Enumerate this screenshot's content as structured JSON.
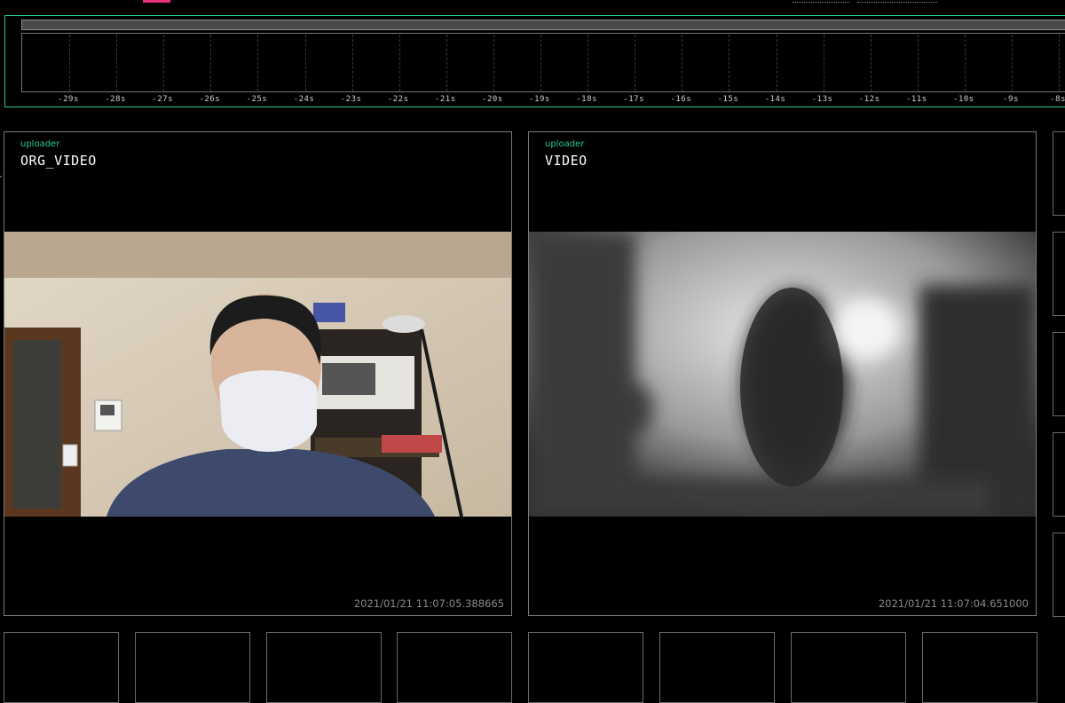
{
  "timeline": {
    "ticks": [
      "-29s",
      "-28s",
      "-27s",
      "-26s",
      "-25s",
      "-24s",
      "-23s",
      "-22s",
      "-21s",
      "-20s",
      "-19s",
      "-18s",
      "-17s",
      "-16s",
      "-15s",
      "-14s",
      "-13s",
      "-12s",
      "-11s",
      "-10s",
      "-9s",
      "-8s"
    ]
  },
  "cards": [
    {
      "subtitle": "uploader",
      "title": "ORG_VIDEO",
      "timestamp": "2021/01/21 11:07:05.388665"
    },
    {
      "subtitle": "uploader",
      "title": "VIDEO",
      "timestamp": "2021/01/21 11:07:04.651000"
    }
  ],
  "colors": {
    "accent": "#27c98b",
    "brand": "#e8337c",
    "background": "#000000"
  }
}
